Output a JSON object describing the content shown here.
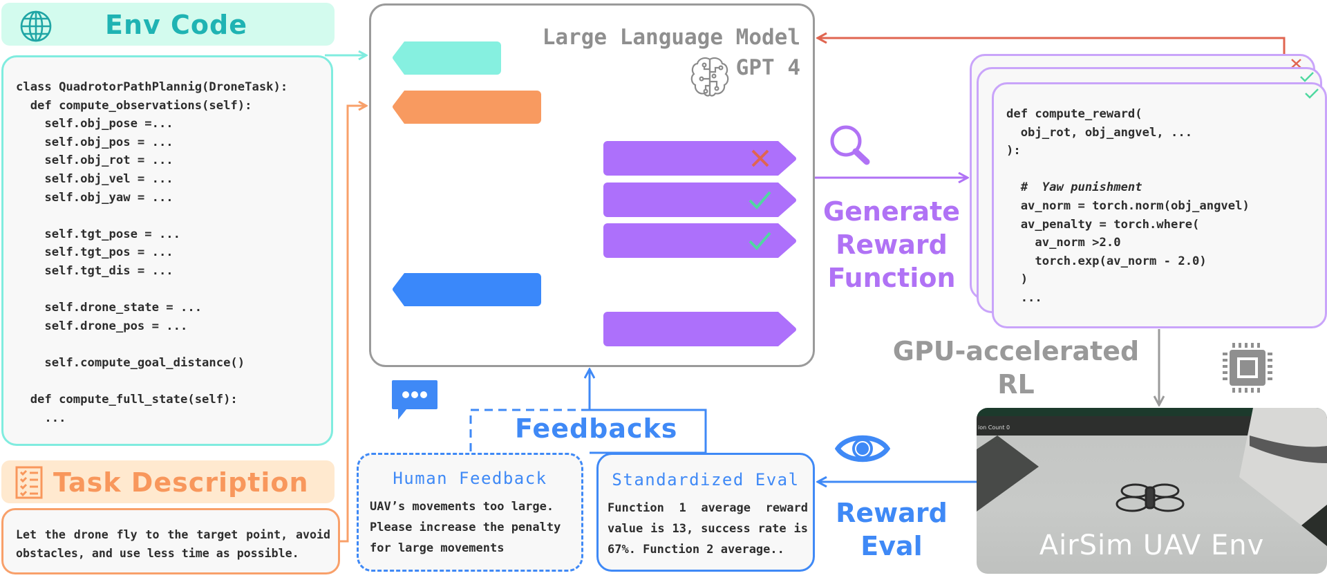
{
  "env_code": {
    "title": "Env Code",
    "icon": "globe-icon",
    "code": "class QuadrotorPathPlannig(DroneTask):\n  def compute_observations(self):\n    self.obj_pose =...\n    self.obj_pos = ...\n    self.obj_rot = ...\n    self.obj_vel = ...\n    self.obj_yaw = ...\n\n    self.tgt_pose = ...\n    self.tgt_pos = ...\n    self.tgt_dis = ...\n\n    self.drone_state = ...\n    self.drone_pos = ...\n\n    self.compute_goal_distance()\n\n  def compute_full_state(self):\n    ..."
  },
  "task_description": {
    "title": "Task Description",
    "icon": "checklist-icon",
    "text": "Let the drone fly to the target point, avoid obstacles, and use less time as possible."
  },
  "llm": {
    "title": "Large Language Model",
    "model": "GPT 4",
    "icon": "brain-circuit-icon",
    "inputs": [
      {
        "name": "env-code-input",
        "color": "#86f0e0"
      },
      {
        "name": "task-description-input",
        "color": "#f89a60"
      },
      {
        "name": "feedback-input",
        "color": "#3a88fa"
      }
    ],
    "outputs": [
      {
        "name": "reward-candidate-1",
        "color": "#ad70fb",
        "status": "rejected",
        "status_color": "#e06550"
      },
      {
        "name": "reward-candidate-2",
        "color": "#ad70fb",
        "status": "accepted",
        "status_color": "#4fd8a0"
      },
      {
        "name": "reward-candidate-3",
        "color": "#ad70fb",
        "status": "accepted",
        "status_color": "#4fd8a0"
      },
      {
        "name": "reward-final",
        "color": "#ad70fb",
        "status": "none"
      }
    ]
  },
  "generate": {
    "label_lines": [
      "Generate",
      "Reward",
      "Function"
    ],
    "icon": "search-icon",
    "color": "#b072f5"
  },
  "reward_cards": {
    "card_status": [
      "rejected",
      "accepted",
      "accepted"
    ],
    "code_lines": [
      "def compute_reward(",
      "  obj_rot, obj_angvel, ...",
      "):",
      "",
      "  #  ",
      "  av_norm = torch.norm(obj_angvel)",
      "  av_penalty = torch.where(",
      "    av_norm >2.0",
      "    torch.exp(av_norm - 2.0)",
      "  )",
      "  ..."
    ],
    "comment": "Yaw punishment"
  },
  "gpu": {
    "label_lines": [
      "GPU-accelerated",
      "RL"
    ],
    "icon": "cpu-chip-icon",
    "color": "#999999"
  },
  "airsim": {
    "caption": "AirSim UAV Env",
    "hud_text": "ion Count 0"
  },
  "reward_eval": {
    "label_lines": [
      "Reward",
      "Eval"
    ],
    "icon": "eye-icon",
    "color": "#3f89f6"
  },
  "feedbacks": {
    "label": "Feedbacks",
    "icon": "chat-bubble-icon",
    "human": {
      "title": "Human Feedback",
      "text": "UAV’s movements too large. Please increase the penalty for large movements"
    },
    "standardized": {
      "title": "Standardized Eval",
      "text": "Function 1 average reward value is 13, success rate is 67%. Function 2 average.."
    }
  },
  "colors": {
    "teal": "#80ecdf",
    "orange": "#f8a06a",
    "purple": "#b072f5",
    "blue": "#3f89f6",
    "red": "#e06550",
    "gray": "#9a9a9a",
    "green": "#4fd8a0"
  }
}
